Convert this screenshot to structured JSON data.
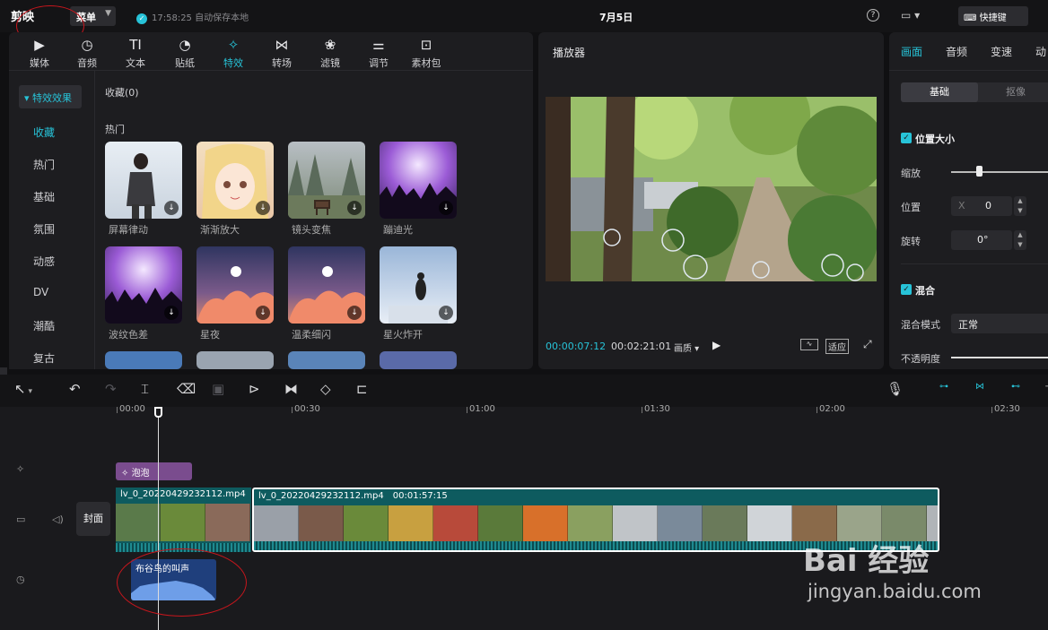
{
  "topbar": {
    "logo": "剪映",
    "menu_label": "菜单",
    "autosave": "17:58:25 自动保存本地",
    "project_title": "7月5日",
    "shortcut_label": "快捷键"
  },
  "media_tabs": [
    {
      "label": "媒体",
      "icon": "media-icon"
    },
    {
      "label": "音频",
      "icon": "audio-icon"
    },
    {
      "label": "文本",
      "icon": "text-icon"
    },
    {
      "label": "贴纸",
      "icon": "sticker-icon"
    },
    {
      "label": "特效",
      "icon": "effects-icon",
      "active": true
    },
    {
      "label": "转场",
      "icon": "transition-icon"
    },
    {
      "label": "滤镜",
      "icon": "filter-icon"
    },
    {
      "label": "调节",
      "icon": "adjust-icon"
    },
    {
      "label": "素材包",
      "icon": "package-icon"
    }
  ],
  "effects_sidebar": {
    "category": "特效效果",
    "items": [
      "收藏",
      "热门",
      "基础",
      "氛围",
      "动感",
      "DV",
      "潮酷",
      "复古"
    ]
  },
  "effects_grid": {
    "favorites_label": "收藏(0)",
    "hot_label": "热门",
    "cards": [
      "屏幕律动",
      "渐渐放大",
      "镜头变焦",
      "蹦迪光",
      "波纹色差",
      "星夜",
      "温柔细闪",
      "星火炸开"
    ]
  },
  "player": {
    "title": "播放器",
    "current_time": "00:00:07:12",
    "total_time": "00:02:21:01",
    "quality_label": "画质",
    "fit_label": "适应"
  },
  "inspector": {
    "tabs": [
      "画面",
      "音频",
      "变速",
      "动"
    ],
    "segment": [
      "基础",
      "抠像"
    ],
    "position_size_label": "位置大小",
    "scale_label": "缩放",
    "position_label": "位置",
    "x_axis": "X",
    "x_value": "0",
    "rotation_label": "旋转",
    "rotation_value": "0°",
    "blend_label": "混合",
    "blend_mode_label": "混合模式",
    "blend_mode_value": "正常",
    "opacity_label": "不透明度"
  },
  "timeline": {
    "ruler_labels": [
      "00:00",
      "00:30",
      "01:00",
      "01:30",
      "02:00",
      "02:30"
    ],
    "effect_clip": "泡泡",
    "cover_label": "封面",
    "clip1_name": "lv_0_20220429232112.mp4",
    "clip2_name": "lv_0_20220429232112.mp4",
    "clip2_duration": "00:01:57:15",
    "audio_clip": "布谷鸟的叫声"
  },
  "watermark": {
    "brand": "Bai 经验",
    "url": "jingyan.baidu.com"
  },
  "colors": {
    "accent": "#27c3d8",
    "annotation": "#c8161d",
    "effect_clip": "#7a4c8e",
    "video_track": "#0e5b5f",
    "audio_track": "#1f3f7c"
  }
}
